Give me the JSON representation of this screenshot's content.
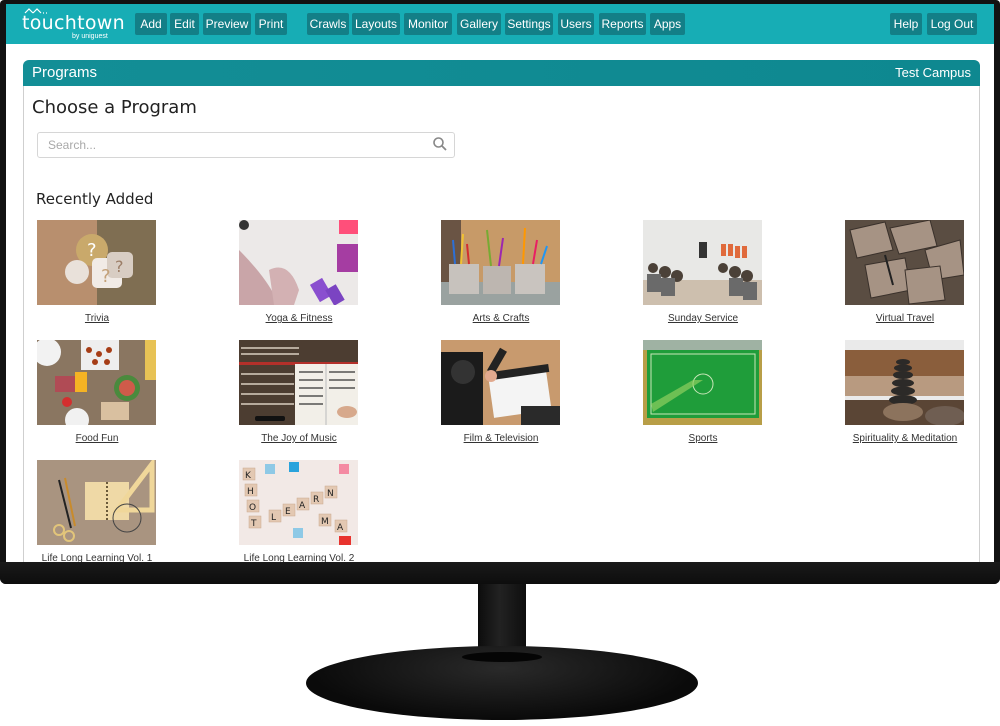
{
  "app": {
    "logo_name": "touchtown",
    "logo_wave": "^^..",
    "logo_sub": "by uniguest",
    "brand_color": "#17adb5",
    "button_color": "#137f87"
  },
  "nav": {
    "left_group": [
      "Add",
      "Edit",
      "Preview",
      "Print"
    ],
    "main_group": [
      "Crawls",
      "Layouts",
      "Monitor",
      "Gallery",
      "Settings",
      "Users",
      "Reports",
      "Apps"
    ],
    "right_group": [
      "Help",
      "Log Out"
    ]
  },
  "panel": {
    "title": "Programs",
    "campus": "Test Campus"
  },
  "main": {
    "heading": "Choose a Program",
    "search_placeholder": "Search...",
    "search_value": "",
    "section_title": "Recently Added"
  },
  "programs": [
    {
      "label": "Trivia",
      "icon": "question-marks-image"
    },
    {
      "label": "Yoga & Fitness",
      "icon": "sneakers-dumbbells-image"
    },
    {
      "label": "Arts & Crafts",
      "icon": "art-supplies-image"
    },
    {
      "label": "Sunday Service",
      "icon": "congregation-image"
    },
    {
      "label": "Virtual Travel",
      "icon": "maps-image"
    },
    {
      "label": "Food Fun",
      "icon": "food-table-image"
    },
    {
      "label": "The Joy of Music",
      "icon": "piano-sheet-music-image"
    },
    {
      "label": "Film & Television",
      "icon": "clapperboard-image"
    },
    {
      "label": "Sports",
      "icon": "sports-field-image"
    },
    {
      "label": "Spirituality & Meditation",
      "icon": "stacked-stones-image"
    },
    {
      "label": "Life Long Learning Vol. 1",
      "icon": "stationery-image"
    },
    {
      "label": "Life Long Learning Vol. 2",
      "icon": "scrabble-tiles-image"
    }
  ]
}
